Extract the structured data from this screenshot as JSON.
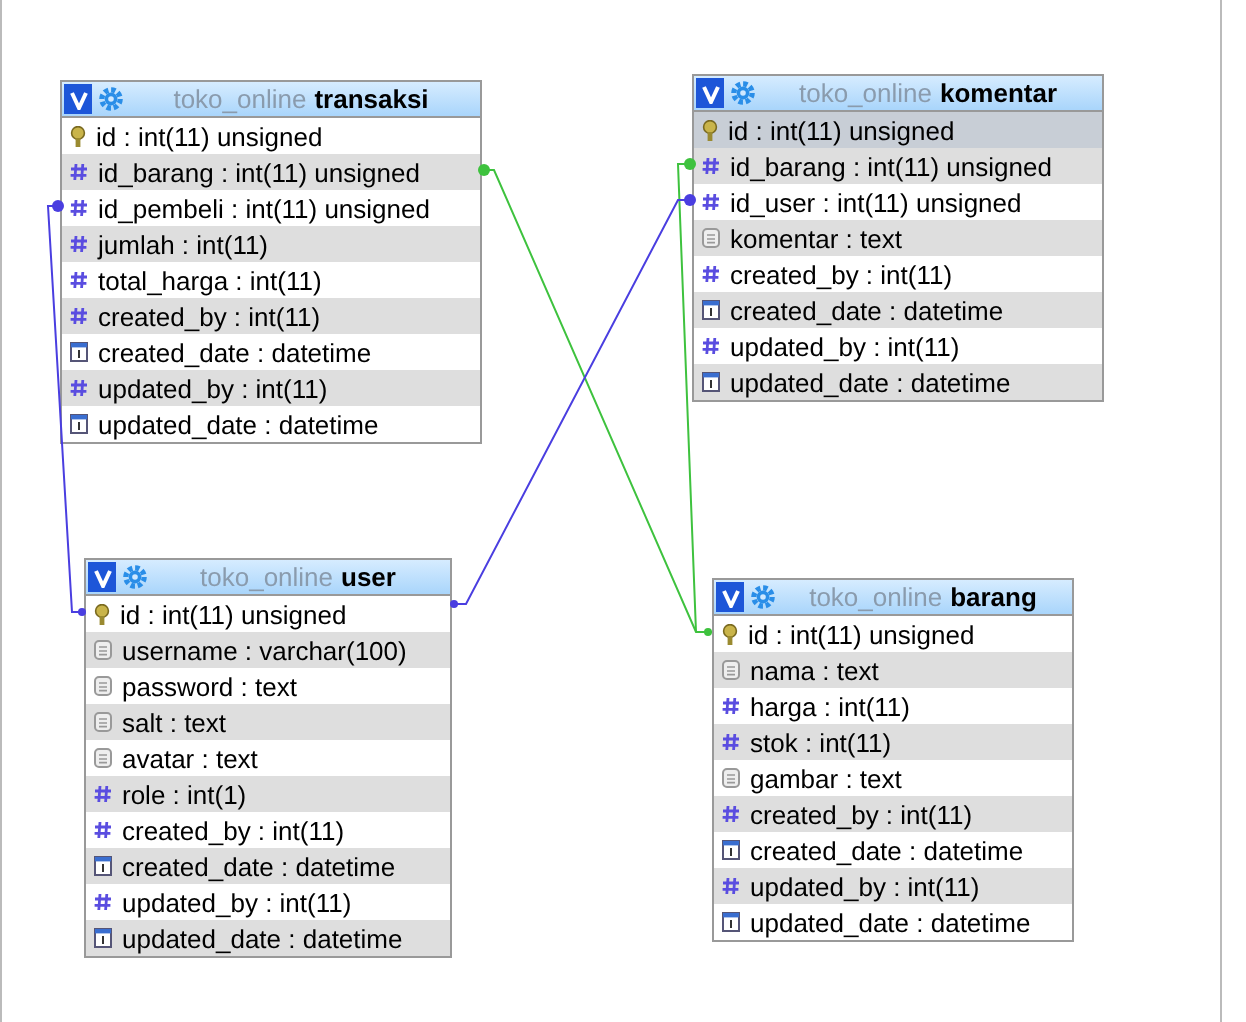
{
  "tables": [
    {
      "schema": "toko_online",
      "name": "transaksi",
      "fields": [
        {
          "kind": "key",
          "label": "id : int(11) unsigned",
          "highlighted": false
        },
        {
          "kind": "number",
          "label": "id_barang : int(11) unsigned",
          "highlighted": false
        },
        {
          "kind": "number",
          "label": "id_pembeli : int(11) unsigned",
          "highlighted": false
        },
        {
          "kind": "number",
          "label": "jumlah : int(11)",
          "highlighted": false
        },
        {
          "kind": "number",
          "label": "total_harga : int(11)",
          "highlighted": false
        },
        {
          "kind": "number",
          "label": "created_by : int(11)",
          "highlighted": false
        },
        {
          "kind": "date",
          "label": "created_date : datetime",
          "highlighted": false
        },
        {
          "kind": "number",
          "label": "updated_by : int(11)",
          "highlighted": false
        },
        {
          "kind": "date",
          "label": "updated_date : datetime",
          "highlighted": false
        }
      ]
    },
    {
      "schema": "toko_online",
      "name": "komentar",
      "fields": [
        {
          "kind": "key",
          "label": "id : int(11) unsigned",
          "highlighted": true
        },
        {
          "kind": "number",
          "label": "id_barang : int(11) unsigned",
          "highlighted": false
        },
        {
          "kind": "number",
          "label": "id_user : int(11) unsigned",
          "highlighted": false
        },
        {
          "kind": "text",
          "label": "komentar : text",
          "highlighted": false
        },
        {
          "kind": "number",
          "label": "created_by : int(11)",
          "highlighted": false
        },
        {
          "kind": "date",
          "label": "created_date : datetime",
          "highlighted": false
        },
        {
          "kind": "number",
          "label": "updated_by : int(11)",
          "highlighted": false
        },
        {
          "kind": "date",
          "label": "updated_date : datetime",
          "highlighted": false
        }
      ]
    },
    {
      "schema": "toko_online",
      "name": "user",
      "fields": [
        {
          "kind": "key",
          "label": "id : int(11) unsigned",
          "highlighted": false
        },
        {
          "kind": "text",
          "label": "username : varchar(100)",
          "highlighted": false
        },
        {
          "kind": "text",
          "label": "password : text",
          "highlighted": false
        },
        {
          "kind": "text",
          "label": "salt : text",
          "highlighted": false
        },
        {
          "kind": "text",
          "label": "avatar : text",
          "highlighted": false
        },
        {
          "kind": "number",
          "label": "role : int(1)",
          "highlighted": false
        },
        {
          "kind": "number",
          "label": "created_by : int(11)",
          "highlighted": false
        },
        {
          "kind": "date",
          "label": "created_date : datetime",
          "highlighted": false
        },
        {
          "kind": "number",
          "label": "updated_by : int(11)",
          "highlighted": false
        },
        {
          "kind": "date",
          "label": "updated_date : datetime",
          "highlighted": false
        }
      ]
    },
    {
      "schema": "toko_online",
      "name": "barang",
      "fields": [
        {
          "kind": "key",
          "label": "id : int(11) unsigned",
          "highlighted": false
        },
        {
          "kind": "text",
          "label": "nama : text",
          "highlighted": false
        },
        {
          "kind": "number",
          "label": "harga : int(11)",
          "highlighted": false
        },
        {
          "kind": "number",
          "label": "stok : int(11)",
          "highlighted": false
        },
        {
          "kind": "text",
          "label": "gambar : text",
          "highlighted": false
        },
        {
          "kind": "number",
          "label": "created_by : int(11)",
          "highlighted": false
        },
        {
          "kind": "date",
          "label": "created_date : datetime",
          "highlighted": false
        },
        {
          "kind": "number",
          "label": "updated_by : int(11)",
          "highlighted": false
        },
        {
          "kind": "date",
          "label": "updated_date : datetime",
          "highlighted": false
        }
      ]
    }
  ]
}
